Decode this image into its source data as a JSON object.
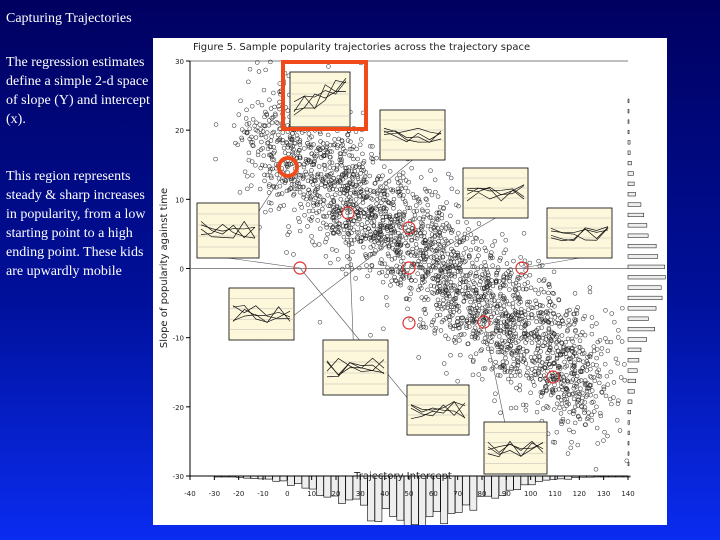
{
  "slide": {
    "title": "Capturing Trajectories",
    "paragraphs": [
      "The regression estimates define a simple 2-d space of slope (Y) and intercept (x).",
      "This region represents steady & sharp increases in popularity, from a low starting point to a high ending point.  These kids are upwardly mobile"
    ]
  },
  "figure": {
    "title": "Figure 5. Sample popularity trajectories across the trajectory space",
    "xlabel": "Trajectory Intercept",
    "ylabel": "Slope of popularity against time",
    "xticks": [
      "-40",
      "-30",
      "-20",
      "-10",
      "0",
      "10",
      "20",
      "30",
      "40",
      "50",
      "60",
      "70",
      "80",
      "90",
      "100",
      "110",
      "120",
      "130",
      "140"
    ],
    "yticks": [
      "30",
      "20",
      "10",
      "0",
      "-10",
      "-20",
      "-30"
    ],
    "highlight_color": "#f04a1a",
    "marker_color": "#e03030",
    "inset_fill": "#fdf8dc"
  }
}
